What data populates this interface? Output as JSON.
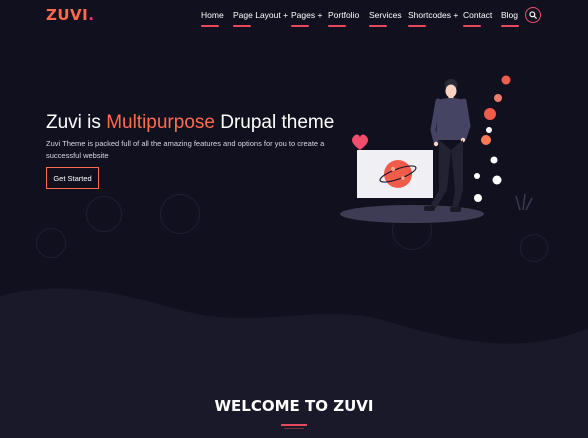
{
  "header": {
    "logo_text": "ZUVI",
    "logo_dot": ".",
    "nav": [
      {
        "label": "Home"
      },
      {
        "label": "Page Layout +"
      },
      {
        "label": "Pages +"
      },
      {
        "label": "Portfolio"
      },
      {
        "label": "Services"
      },
      {
        "label": "Shortcodes +"
      },
      {
        "label": "Contact"
      },
      {
        "label": "Blog"
      }
    ],
    "search_icon": "search-icon"
  },
  "hero": {
    "title_pre": "Zuvi is ",
    "title_accent": "Multipurpose",
    "title_post": " Drupal theme",
    "description": "Zuvi Theme is packed full of all the amazing features and options for you to create a successful website",
    "cta_label": "Get Started"
  },
  "section": {
    "welcome_title": "WELCOME TO ZUVI"
  },
  "colors": {
    "background": "#11101f",
    "accent": "#ff6b4f",
    "underline": "#e8485e",
    "wave": "#1a1929"
  }
}
